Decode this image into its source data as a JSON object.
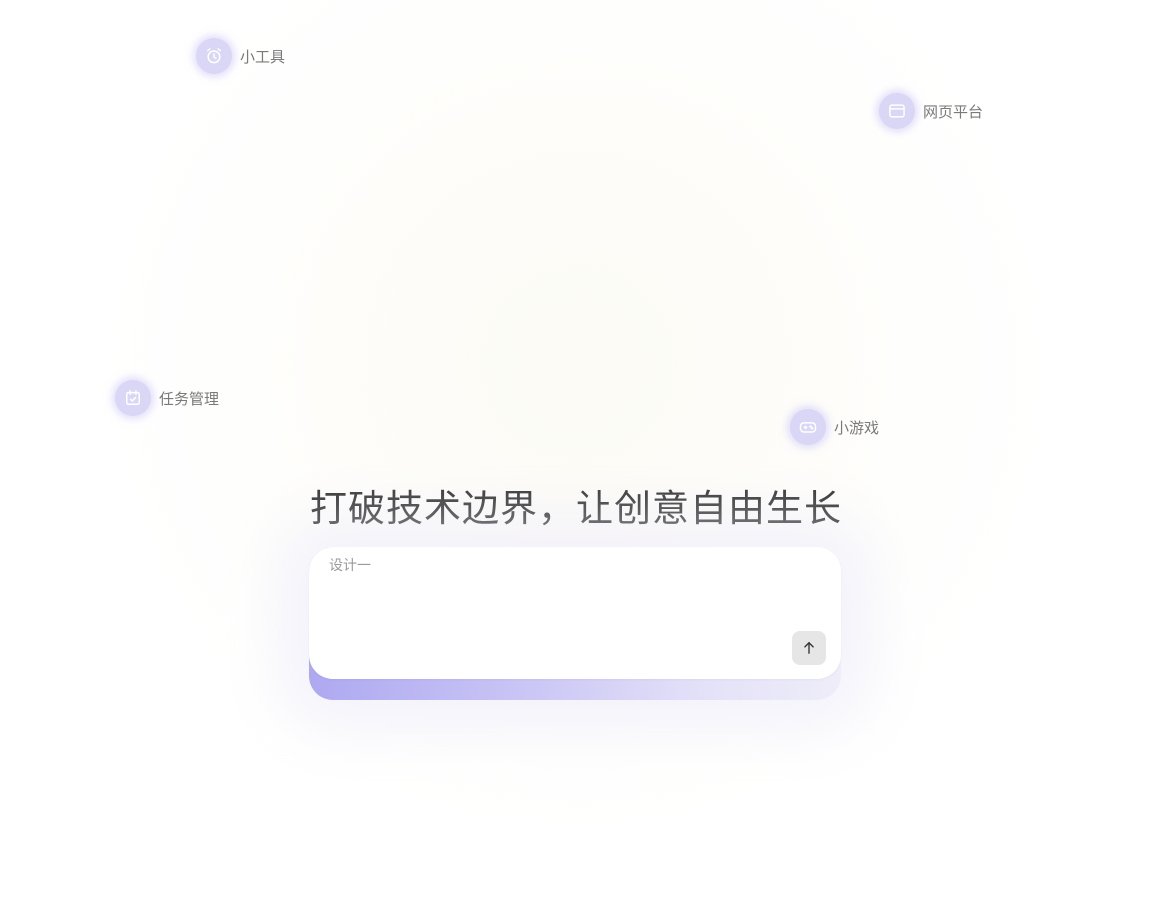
{
  "tags": {
    "tools": {
      "label": "小工具",
      "icon": "alarm-clock-icon"
    },
    "web": {
      "label": "网页平台",
      "icon": "browser-window-icon"
    },
    "tasks": {
      "label": "任务管理",
      "icon": "calendar-check-icon"
    },
    "games": {
      "label": "小游戏",
      "icon": "gamepad-icon"
    }
  },
  "headline": "打破技术边界，让创意自由生长",
  "prompt": {
    "placeholder": "设计一",
    "send_icon": "arrow-up-icon"
  },
  "colors": {
    "tag_icon_bg": "#d9d6f6",
    "tag_icon_stroke": "#ffffff",
    "accent_gradient_start": "#aea8f1",
    "accent_gradient_end": "#eeedf8",
    "headline": "#333333",
    "send_button_bg": "#e6e6e6"
  }
}
